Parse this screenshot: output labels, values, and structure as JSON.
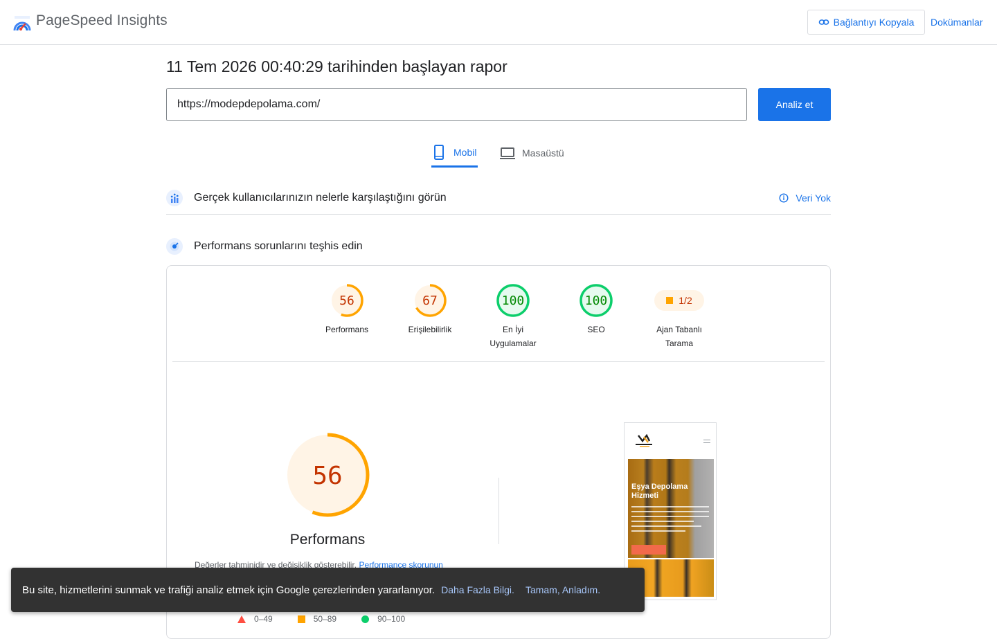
{
  "header": {
    "brand": "PageSpeed Insights",
    "copy_label": "Bağlantıyı Kopyala",
    "docs_label": "Dokümanlar"
  },
  "report": {
    "title": "11 Tem 2026 00:40:29 tarihinden başlayan rapor",
    "url_value": "https://modepdepolama.com/",
    "analyze_label": "Analiz et"
  },
  "tabs": {
    "mobile": "Mobil",
    "desktop": "Masaüstü"
  },
  "field": {
    "title": "Gerçek kullanıcılarınızın nelerle karşılaştığını görün",
    "nodata": "Veri Yok"
  },
  "diagnose": {
    "title": "Performans sorunlarını teşhis edin"
  },
  "scores": [
    {
      "value": "56",
      "label": "Performans",
      "color": "#ffa400",
      "text_color": "#c33300",
      "fraction": 0.56
    },
    {
      "value": "67",
      "label": "Erişilebilirlik",
      "color": "#ffa400",
      "text_color": "#c33300",
      "fraction": 0.67
    },
    {
      "value": "100",
      "label_line1": "En İyi",
      "label_line2": "Uygulamalar",
      "color": "#0cce6b",
      "text_color": "#008800",
      "fraction": 1.0
    },
    {
      "value": "100",
      "label": "SEO",
      "color": "#0cce6b",
      "text_color": "#008800",
      "fraction": 1.0
    },
    {
      "value": "1/2",
      "label_line1": "Ajan Tabanlı",
      "label_line2": "Tarama"
    }
  ],
  "performance": {
    "score": "56",
    "fraction": 0.56,
    "title": "Performans",
    "note": "Değerler tahminidir ve değişiklik gösterebilir.",
    "note_link": "Performance skorunun"
  },
  "legend": {
    "fail": "0–49",
    "average": "50–89",
    "pass": "90–100"
  },
  "screenshot": {
    "hero_title": "Eşya Depolama Hizmeti"
  },
  "toast": {
    "message": "Bu site, hizmetlerini sunmak ve trafiği analiz etmek için Google çerezlerinden yararlanıyor.",
    "learn_more": "Daha Fazla Bilgi.",
    "ok": "Tamam, Anladım."
  },
  "colors": {
    "accent": "#1a73e8",
    "average": "#ffa400",
    "pass": "#0cce6b",
    "fail": "#ff4e42"
  }
}
